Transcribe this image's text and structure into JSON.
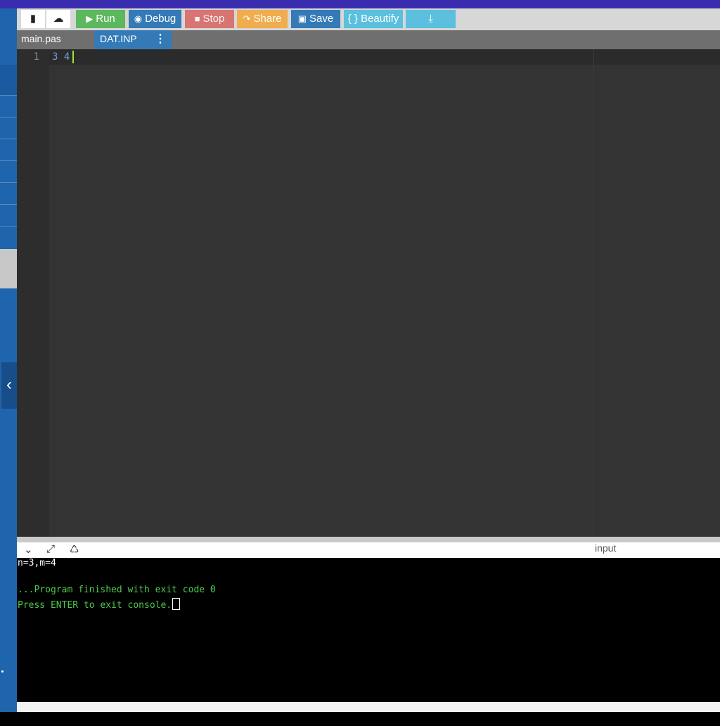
{
  "toolbar": {
    "buttons": [
      {
        "id": "new",
        "icon": "file-icon",
        "label": ""
      },
      {
        "id": "upload",
        "icon": "cloud-upload-icon",
        "label": ""
      },
      {
        "id": "run",
        "icon": "play-icon",
        "label": "Run"
      },
      {
        "id": "debug",
        "icon": "debug-icon",
        "label": "Debug"
      },
      {
        "id": "stop",
        "icon": "stop-icon",
        "label": "Stop"
      },
      {
        "id": "share",
        "icon": "share-icon",
        "label": "Share"
      },
      {
        "id": "save",
        "icon": "save-icon",
        "label": "Save"
      },
      {
        "id": "beautify",
        "icon": "braces-icon",
        "label": "{ } Beautify"
      },
      {
        "id": "download",
        "icon": "download-icon",
        "label": ""
      }
    ],
    "colors": {
      "run": "#5cb85c",
      "debug": "#337ab7",
      "stop": "#d9534f",
      "share": "#f0ad4e",
      "save": "#337ab7",
      "beautify": "#5bc0de",
      "download": "#5bc0de"
    }
  },
  "tabs": [
    {
      "label": "main.pas",
      "active": false
    },
    {
      "label": "DAT.INP",
      "active": true
    }
  ],
  "editor": {
    "lines": [
      {
        "number": "1",
        "text": "3 4"
      }
    ]
  },
  "console_bar": {
    "input_label": "input"
  },
  "console": {
    "lines": [
      {
        "text": "n=3,m=4",
        "color": "#ffffff"
      },
      {
        "text": "",
        "color": "#ffffff"
      },
      {
        "text": "...Program finished with exit code 0",
        "color": "#4ec94e"
      },
      {
        "text": "Press ENTER to exit console.",
        "color": "#4ec94e"
      }
    ]
  }
}
